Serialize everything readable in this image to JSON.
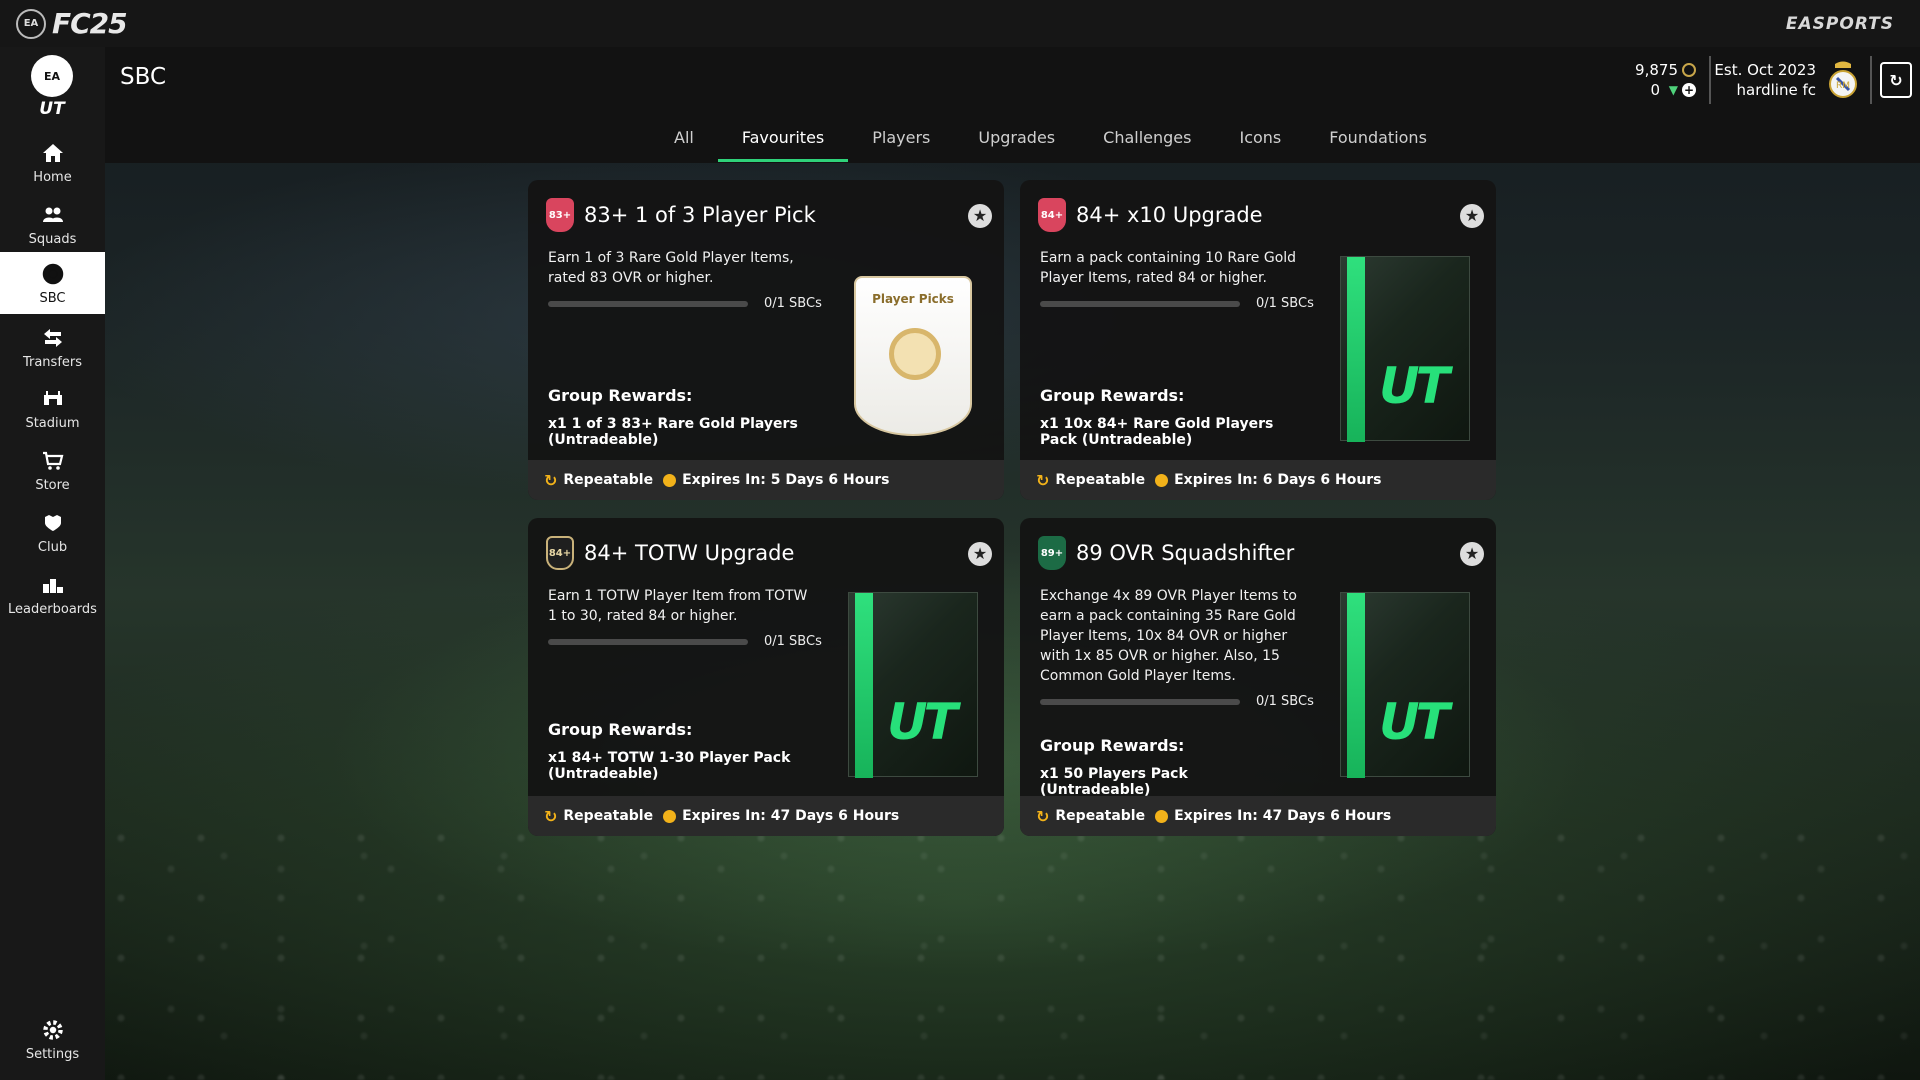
{
  "topbar": {
    "game_logo": "FC25",
    "publisher_logo": "EASPORTS"
  },
  "sidebar": {
    "logo": "UT",
    "items": [
      {
        "label": "Home",
        "icon": "home-icon"
      },
      {
        "label": "Squads",
        "icon": "squads-icon"
      },
      {
        "label": "SBC",
        "icon": "sbc-icon",
        "active": true
      },
      {
        "label": "Transfers",
        "icon": "transfers-icon"
      },
      {
        "label": "Stadium",
        "icon": "stadium-icon"
      },
      {
        "label": "Store",
        "icon": "store-icon"
      },
      {
        "label": "Club",
        "icon": "club-icon"
      },
      {
        "label": "Leaderboards",
        "icon": "leaderboards-icon"
      }
    ],
    "settings_label": "Settings"
  },
  "header": {
    "title": "SBC",
    "coins": "9,875",
    "points": "0",
    "club_est": "Est. Oct 2023",
    "club_name": "hardline fc"
  },
  "tabs": [
    {
      "label": "All"
    },
    {
      "label": "Favourites",
      "active": true
    },
    {
      "label": "Players"
    },
    {
      "label": "Upgrades"
    },
    {
      "label": "Challenges"
    },
    {
      "label": "Icons"
    },
    {
      "label": "Foundations"
    }
  ],
  "cards": [
    {
      "badge": "83+",
      "title": "83+ 1 of 3 Player Pick",
      "description": "Earn 1 of 3 Rare Gold Player Items, rated 83 OVR or higher.",
      "progress_text": "0/1 SBCs",
      "progress": 0,
      "rewards_title": "Group Rewards:",
      "rewards": "x1 1 of 3 83+ Rare Gold Players (Untradeable)",
      "repeatable": "Repeatable",
      "expires": "Expires In: 5 Days 6 Hours",
      "art_label": "Player Picks"
    },
    {
      "badge": "84+",
      "title": "84+ x10 Upgrade",
      "description": "Earn a pack containing 10 Rare Gold Player Items, rated 84 or higher.",
      "progress_text": "0/1 SBCs",
      "progress": 0,
      "rewards_title": "Group Rewards:",
      "rewards": "x1 10x 84+ Rare Gold Players Pack (Untradeable)",
      "repeatable": "Repeatable",
      "expires": "Expires In: 6 Days 6 Hours",
      "art_label": "UT"
    },
    {
      "badge": "84+",
      "title": "84+ TOTW Upgrade",
      "description": "Earn 1 TOTW Player Item from TOTW 1 to 30, rated 84 or higher.",
      "progress_text": "0/1 SBCs",
      "progress": 0,
      "rewards_title": "Group Rewards:",
      "rewards": "x1 84+ TOTW 1-30 Player Pack (Untradeable)",
      "repeatable": "Repeatable",
      "expires": "Expires In: 47 Days 6 Hours",
      "art_label": "UT"
    },
    {
      "badge": "89+",
      "title": "89 OVR Squadshifter",
      "description": "Exchange 4x 89 OVR Player Items to earn a pack containing 35 Rare Gold Player Items, 10x 84 OVR or higher with 1x 85 OVR or higher. Also, 15 Common Gold Player Items.",
      "progress_text": "0/1 SBCs",
      "progress": 0,
      "rewards_title": "Group Rewards:",
      "rewards": "x1 50 Players Pack (Untradeable)",
      "repeatable": "Repeatable",
      "expires": "Expires In: 47 Days 6 Hours",
      "art_label": "UT"
    }
  ],
  "colors": {
    "accent": "#2fd27a",
    "coin": "#c8a64a",
    "timer": "#f2b21a"
  }
}
